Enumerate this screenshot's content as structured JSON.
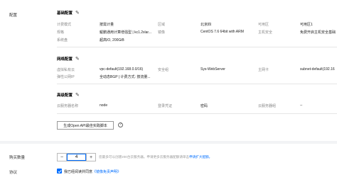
{
  "config": {
    "section_label": "配置",
    "basic": {
      "title": "基础配置",
      "rows": [
        [
          {
            "k": "计费模式",
            "v": "按需计量"
          },
          {
            "k": "区域",
            "v": "北京四"
          },
          {
            "k": "可用区",
            "v": "可用区1"
          }
        ],
        [
          {
            "k": "规格",
            "v": "鲲鹏通用计算增强型 | kc1.2xlar..."
          },
          {
            "k": "镜像",
            "v": "CentOS 7.6 64bit with ARM"
          },
          {
            "k": "主机安全",
            "v": "免费开启主机安全基础"
          }
        ],
        [
          {
            "k": "系统盘",
            "v": "超高IO, 200GiB"
          }
        ]
      ]
    },
    "network": {
      "title": "网络配置",
      "rows": [
        [
          {
            "k": "虚拟私有云",
            "v": "vpc-default(192.168.0.0/16)"
          },
          {
            "k": "安全组",
            "v": "Sys-WebServer"
          },
          {
            "k": "主网卡",
            "v": "subnet-default(192.16"
          }
        ],
        [
          {
            "k": "弹性公网IP",
            "v": "全动态BGP | 计费方式: 按流量..."
          }
        ]
      ]
    },
    "advanced": {
      "title": "高级配置",
      "rows": [
        [
          {
            "k": "云服务器名称",
            "v": "node"
          },
          {
            "k": "登录凭证",
            "v": "密码"
          },
          {
            "k": "云服务器组",
            "v": "--"
          }
        ]
      ]
    },
    "api_button_label": "生成Open API最佳实践脚本",
    "help_glyph": "?"
  },
  "purchase": {
    "label": "购买数量",
    "quantity": "4",
    "minus": "−",
    "plus": "+",
    "hint_text": "您最多可以创建200台云服务器。申请更多云服务器配额请单击",
    "hint_link": "申请扩大配额。"
  },
  "agreement": {
    "label": "协议",
    "text": "我已经阅读并同意",
    "link": "《镜像免责声明》"
  },
  "colors": {
    "accent": "#006eff"
  }
}
